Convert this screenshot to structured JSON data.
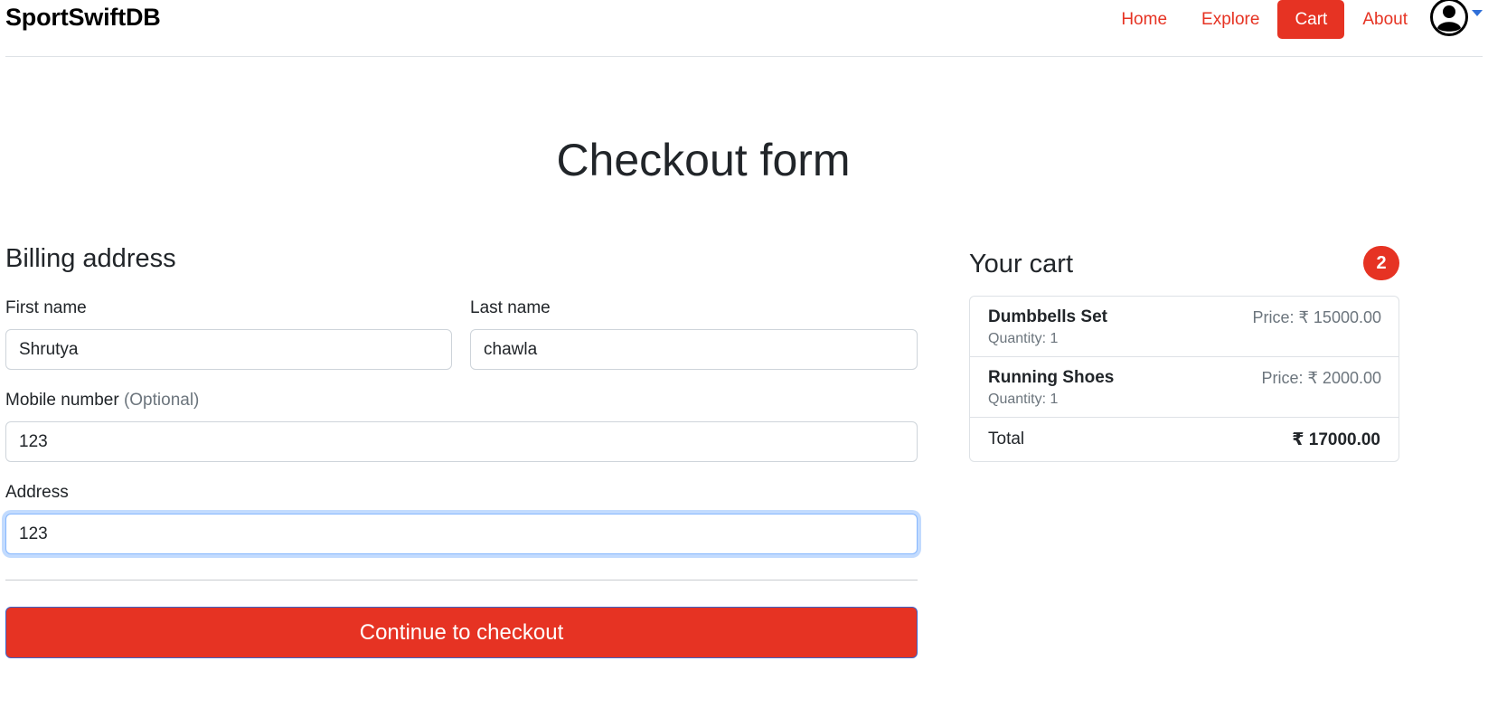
{
  "navbar": {
    "brand": "SportSwiftDB",
    "links": [
      "Home",
      "Explore",
      "Cart",
      "About"
    ],
    "active": "Cart"
  },
  "page": {
    "title": "Checkout form"
  },
  "billing": {
    "heading": "Billing address",
    "first_name": {
      "label": "First name",
      "value": "Shrutya"
    },
    "last_name": {
      "label": "Last name",
      "value": "chawla"
    },
    "mobile": {
      "label": "Mobile number",
      "optional": "(Optional)",
      "value": "123"
    },
    "address": {
      "label": "Address",
      "value": "123"
    },
    "submit": "Continue to checkout"
  },
  "cart": {
    "heading": "Your cart",
    "count": "2",
    "items": [
      {
        "name": "Dumbbells Set",
        "quantity": "Quantity: 1",
        "price": "Price: ₹ 15000.00"
      },
      {
        "name": "Running Shoes",
        "quantity": "Quantity: 1",
        "price": "Price: ₹ 2000.00"
      }
    ],
    "total_label": "Total",
    "total_value": "₹ 17000.00"
  },
  "colors": {
    "accent": "#e63323",
    "focus": "#86b7fe"
  },
  "icons": {
    "user": "user-circle-icon",
    "caret": "caret-down-icon"
  }
}
